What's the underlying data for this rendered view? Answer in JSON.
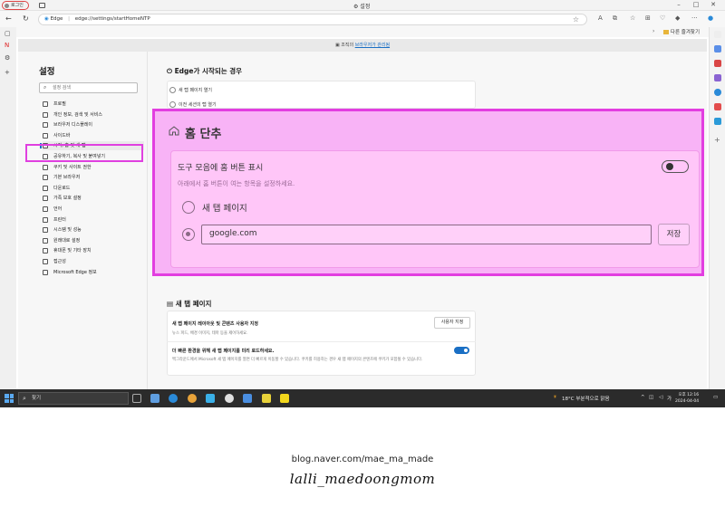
{
  "browser": {
    "profile_label": "로그인",
    "window_title": "설정",
    "site_label": "Edge",
    "url": "edge://settings/startHomeNTP",
    "url_bold": "settings",
    "favorites_folder": "다른 즐겨찾기",
    "managed_text": "조직의",
    "managed_link": "브라우저가 관리됨"
  },
  "sidebar": {
    "title": "설정",
    "search_placeholder": "설정 검색",
    "items": [
      "프로필",
      "개인 정보, 검색 및 서비스",
      "브라우저 디스플레이",
      "사이드바",
      "시작, 홈 및 새 탭",
      "공유하기, 복사 및 붙여넣기",
      "쿠키 및 사이트 권한",
      "기본 브라우저",
      "다운로드",
      "가족 보호 설정",
      "언어",
      "프린터",
      "시스템 및 성능",
      "원래대로 설정",
      "휴대폰 및 기타 장치",
      "접근성",
      "Microsoft Edge 정보"
    ]
  },
  "startup": {
    "heading": "Edge가 시작되는 경우",
    "options": [
      "새 탭 페이지 열기",
      "이전 세션의 탭 열기"
    ]
  },
  "home": {
    "heading": "홈 단추",
    "toggle_label": "도구 모음에 홈 버튼 표시",
    "toggle_sub": "아래에서 홈 버튼이 여는 항목을 설정하세요.",
    "toggle_on": false,
    "option_newtab": "새 탭 페이지",
    "url_value": "google.com",
    "save_label": "저장"
  },
  "newtab": {
    "heading": "새 탭 페이지",
    "row1_title": "새 탭 페이지 레이아웃 및 콘텐츠 사용자 지정",
    "row1_sub": "뉴스 피드, 배경 이미지, 테마 등을 제어하세요.",
    "customize_label": "사용자 지정",
    "row2_title": "더 빠른 환경을 위해 새 탭 페이지를 미리 로드하세요.",
    "row2_sub": "백그라운드에서 Microsoft 새 탭 페이지를 열면 더 빠르게 이동할 수 있습니다. 쿠키를 허용하는 경우 새 탭 페이지의 콘텐츠에 쿠키가 포함될 수 있습니다.",
    "preload_on": true
  },
  "taskbar": {
    "search_placeholder": "찾기",
    "weather": "18°C 부분적으로 맑음",
    "time": "오후 12:16",
    "date": "2024-04-04"
  },
  "footer": {
    "blog_url": "blog.naver.com/mae_ma_made",
    "signature": "lalli_maedoongmom"
  },
  "colors": {
    "accent": "#1a6fc4",
    "highlight": "#e23ee0",
    "overlay_bg": "#f8b3f6"
  }
}
